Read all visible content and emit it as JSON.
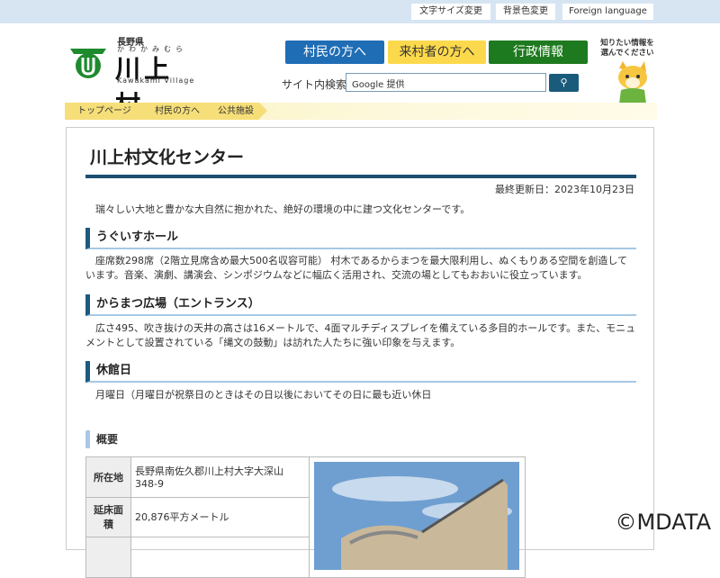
{
  "topbar": {
    "font_size": "文字サイズ変更",
    "bg_color": "背景色変更",
    "foreign": "Foreign language"
  },
  "logo": {
    "prefecture": "長野県",
    "kana": "かわかみむら",
    "name": "川上村",
    "roman": "Kawakami Village"
  },
  "nav": [
    {
      "label": "村民の方へ",
      "color": "#1f6db5"
    },
    {
      "label": "来村者の方へ",
      "color": "#fcd94c"
    },
    {
      "label": "行政情報",
      "color": "#1e7a1e"
    }
  ],
  "search": {
    "label": "サイト内検索",
    "placeholder": "Google 提供",
    "icon": "search-icon"
  },
  "mascot": {
    "text": "知りたい情報を選んでください"
  },
  "breadcrumb": [
    "トップページ",
    "村民の方へ",
    "公共施設"
  ],
  "page": {
    "title": "川上村文化センター",
    "updated": "最終更新日：2023年10月23日",
    "intro": "瑞々しい大地と豊かな大自然に抱かれた、絶好の環境の中に建つ文化センターです。",
    "sections": [
      {
        "heading": "うぐいすホール",
        "body": "座席数298席（2階立見席含め最大500名収容可能） 村木であるからまつを最大限利用し、ぬくもりある空間を創造しています。音楽、演劇、講演会、シンポジウムなどに幅広く活用され、交流の場としてもおおいに役立っています。"
      },
      {
        "heading": "からまつ広場（エントランス）",
        "body": "広さ495、吹き抜けの天井の高さは16メートルで、4面マルチディスプレイを備えている多目的ホールです。また、モニュメントとして設置されている「縄文の鼓動」は訪れた人たちに強い印象を与えます。"
      },
      {
        "heading": "休館日",
        "body": "月曜日（月曜日が祝祭日のときはその日以後においてその日に最も近い休日"
      }
    ],
    "overview": {
      "heading": "概要",
      "rows": [
        {
          "label": "所在地",
          "value": "長野県南佐久郡川上村大字大深山348-9"
        },
        {
          "label": "延床面積",
          "value": "20,876平方メートル"
        }
      ]
    }
  },
  "watermark": "©MDATA"
}
